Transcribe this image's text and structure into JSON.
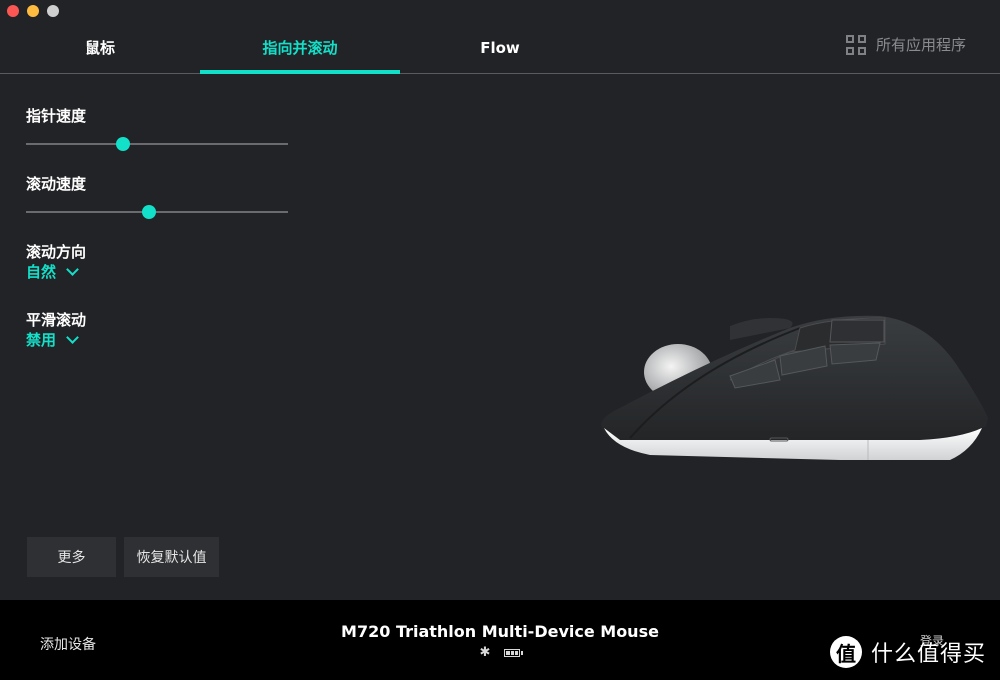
{
  "window": {
    "traffic_lights": [
      "close",
      "minimize",
      "zoom"
    ]
  },
  "tabs": [
    {
      "label": "鼠标",
      "active": false
    },
    {
      "label": "指向并滚动",
      "active": true
    },
    {
      "label": "Flow",
      "active": false
    }
  ],
  "all_apps": {
    "icon": "grid-icon",
    "label": "所有应用程序"
  },
  "settings": {
    "pointer_speed": {
      "label": "指针速度",
      "value_fraction": 0.37
    },
    "scroll_speed": {
      "label": "滚动速度",
      "value_fraction": 0.47
    },
    "scroll_direction": {
      "label": "滚动方向",
      "value": "自然"
    },
    "smooth_scroll": {
      "label": "平滑滚动",
      "value": "禁用"
    }
  },
  "buttons": {
    "more": "更多",
    "restore_defaults": "恢复默认值"
  },
  "footer": {
    "add_device": "添加设备",
    "device_name": "M720 Triathlon Multi-Device Mouse",
    "connection_icon": "bluetooth-icon",
    "battery_icon": "battery-icon",
    "login": "登录"
  },
  "watermark": {
    "logo": "值",
    "text": "什么值得买"
  },
  "colors": {
    "accent": "#12e0c9",
    "background": "#222326",
    "footer": "#000000",
    "button": "#2f3033"
  }
}
